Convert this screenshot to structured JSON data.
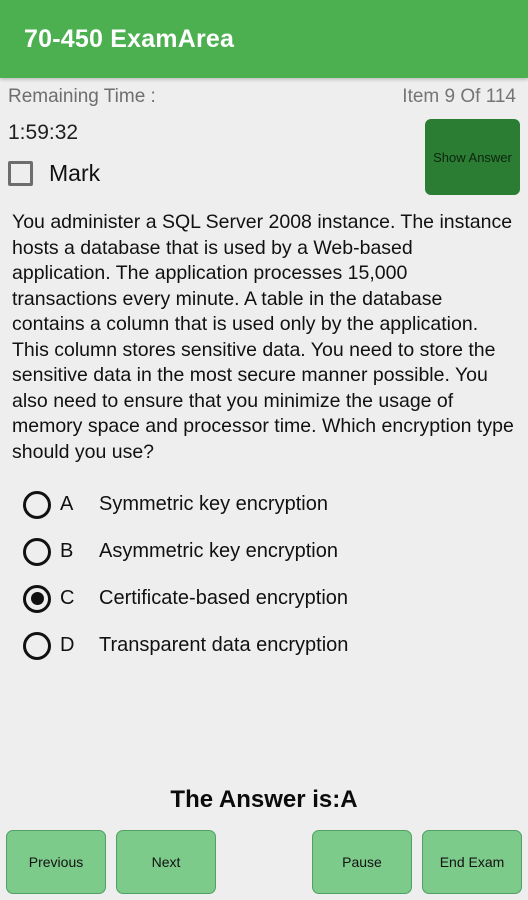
{
  "appbar": {
    "title": "70-450 ExamArea"
  },
  "status": {
    "remaining_time_label": "Remaining Time :",
    "item_counter": "Item 9 Of 114",
    "current_item": 9,
    "total_items": 114
  },
  "timer": {
    "value": "1:59:32"
  },
  "mark": {
    "label": "Mark",
    "checked": false
  },
  "show_answer": {
    "label": "Show Answer"
  },
  "question": {
    "text": "You administer a SQL Server 2008 instance. The instance hosts a database that is used by a Web-based application. The application processes 15,000 transactions every minute. A table in the database contains a column that is used only by the application. This column stores sensitive data. You need to store the sensitive data in the most secure manner possible. You also need to ensure that you minimize the usage of memory space and processor time. Which encryption type should you use?"
  },
  "options": [
    {
      "letter": "A",
      "text": "Symmetric key encryption",
      "selected": false
    },
    {
      "letter": "B",
      "text": "Asymmetric key encryption",
      "selected": false
    },
    {
      "letter": "C",
      "text": "Certificate-based encryption",
      "selected": true
    },
    {
      "letter": "D",
      "text": "Transparent data encryption",
      "selected": false
    }
  ],
  "answer": {
    "text": "The Answer is:A"
  },
  "buttons": {
    "previous": "Previous",
    "next": "Next",
    "pause": "Pause",
    "end_exam": "End Exam"
  },
  "colors": {
    "appbar_green": "#4caf50",
    "show_answer_green": "#2b7d33",
    "nav_button_green": "#7ccb8a",
    "background": "#eeeeee"
  }
}
